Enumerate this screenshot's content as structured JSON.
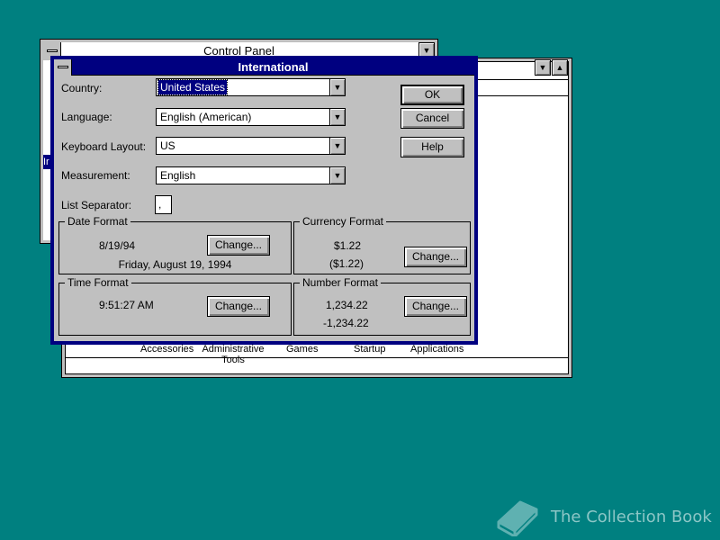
{
  "control_panel": {
    "title": "Control Panel",
    "icons": [
      "Accessories",
      "Administrative Tools",
      "Games",
      "Startup",
      "Applications"
    ],
    "partial_left_label": "Ir"
  },
  "dialog": {
    "title": "International",
    "fields": {
      "country": {
        "label": "Country:",
        "value": "United States"
      },
      "language": {
        "label": "Language:",
        "value": "English (American)"
      },
      "keyboard": {
        "label": "Keyboard Layout:",
        "value": "US"
      },
      "measurement": {
        "label": "Measurement:",
        "value": "English"
      },
      "list_separator": {
        "label": "List Separator:",
        "value": ","
      }
    },
    "buttons": {
      "ok": "OK",
      "cancel": "Cancel",
      "help": "Help"
    },
    "date_format": {
      "title": "Date Format",
      "short": "8/19/94",
      "long": "Friday, August 19, 1994",
      "change": "Change..."
    },
    "currency_format": {
      "title": "Currency Format",
      "positive": "$1.22",
      "negative": "($1.22)",
      "change": "Change..."
    },
    "time_format": {
      "title": "Time Format",
      "value": "9:51:27 AM",
      "change": "Change..."
    },
    "number_format": {
      "title": "Number Format",
      "positive": "1,234.22",
      "negative": "-1,234.22",
      "change": "Change..."
    }
  },
  "watermark": {
    "text": "The Collection Book"
  }
}
